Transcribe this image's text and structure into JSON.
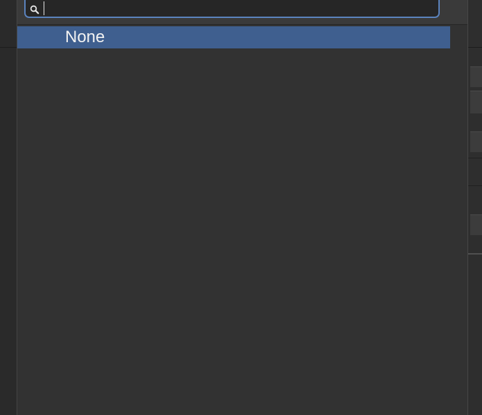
{
  "search": {
    "value": "",
    "placeholder": "",
    "icon": "search-icon"
  },
  "menu": {
    "items": [
      {
        "label": "None",
        "selected": true
      }
    ]
  },
  "colors": {
    "selection": "#3f5f8f",
    "focus_ring": "#5b84bf",
    "panel": "#323232"
  }
}
